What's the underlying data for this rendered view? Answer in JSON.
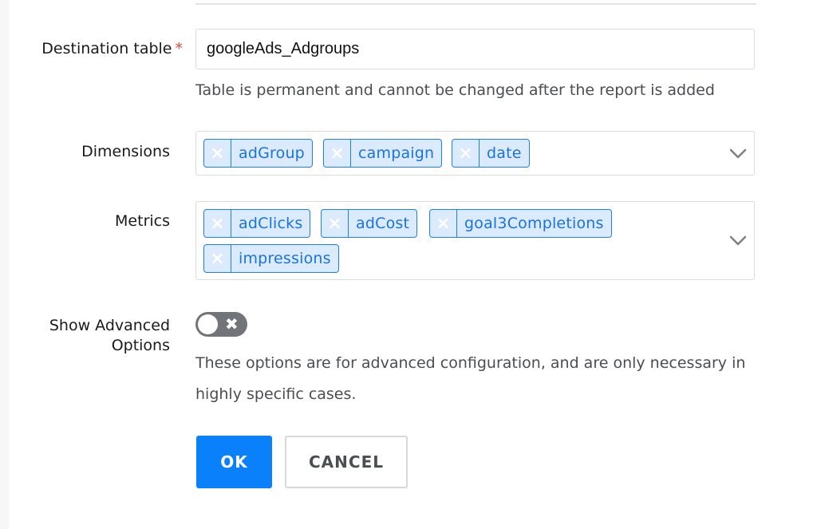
{
  "destination": {
    "label": "Destination table",
    "required_mark": "*",
    "value": "googleAds_Adgroups",
    "hint": "Table is permanent and cannot be changed after the report is added"
  },
  "dimensions": {
    "label": "Dimensions",
    "tags": [
      "adGroup",
      "campaign",
      "date"
    ],
    "remove_icon": "×"
  },
  "metrics": {
    "label": "Metrics",
    "tags": [
      "adClicks",
      "adCost",
      "goal3Completions",
      "impressions"
    ],
    "remove_icon": "×"
  },
  "advanced": {
    "label_line1": "Show Advanced",
    "label_line2": "Options",
    "enabled": false,
    "toggle_icon": "✖",
    "hint_line1": "These options are for advanced configuration, and are only necessary in",
    "hint_line2": "highly specific cases."
  },
  "buttons": {
    "ok": "OK",
    "cancel": "CANCEL"
  },
  "colors": {
    "accent": "#0a80fb",
    "tag_border": "#1e80ec",
    "tag_bg": "#dceafd",
    "required": "#e0453a",
    "toggle_off": "#71757a"
  }
}
